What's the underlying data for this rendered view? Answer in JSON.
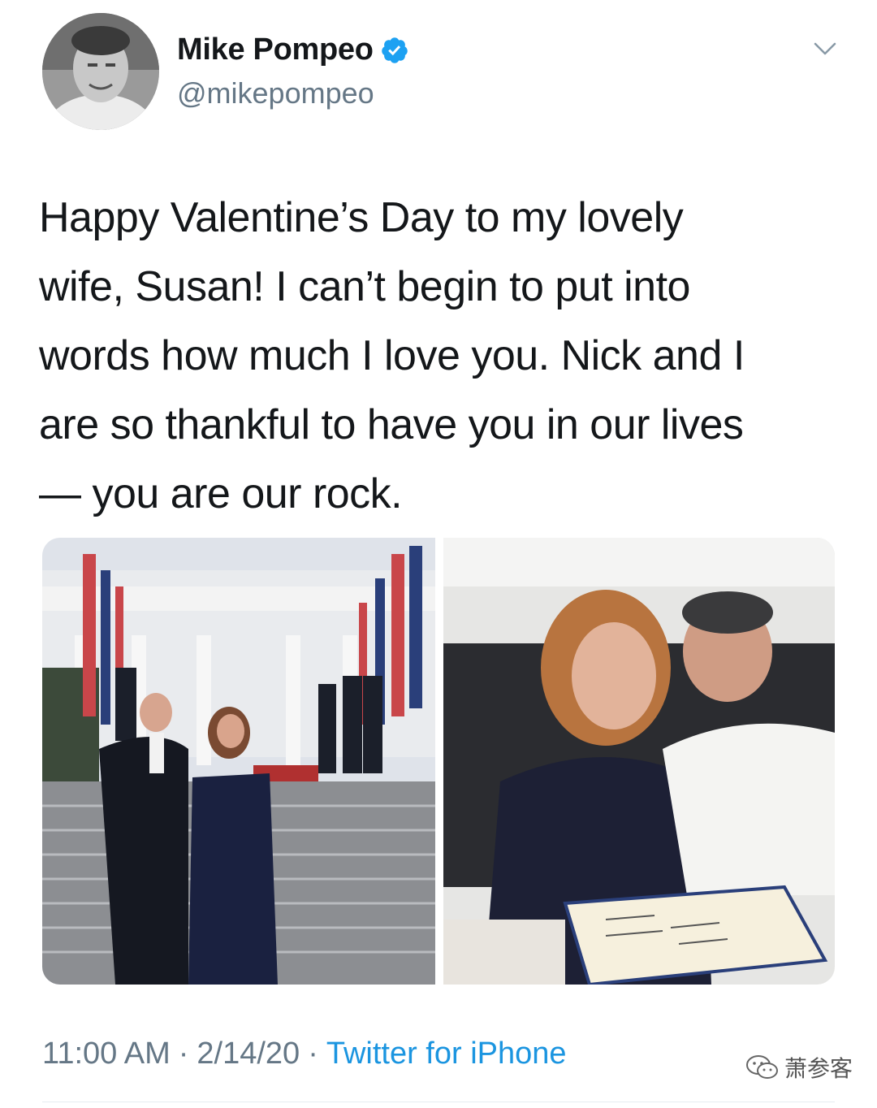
{
  "author": {
    "name": "Mike Pompeo",
    "handle": "@mikepompeo",
    "verified": true,
    "avatar_icon": "profile-photo"
  },
  "menu_icon": "chevron-down-icon",
  "tweet": {
    "text": "Happy Valentine’s Day to my lovely\nwife, Susan! I can’t begin to put into\nwords how much I love you. Nick and I\nare so thankful to have you in our lives\n— you are our rock."
  },
  "media": [
    {
      "name": "photo-couple-white-house-steps"
    },
    {
      "name": "photo-couple-restaurant-table"
    }
  ],
  "meta": {
    "time": "11:00 AM",
    "separator": "·",
    "date": "2/14/20",
    "source": "Twitter for iPhone"
  },
  "watermark": {
    "text": "萧参客",
    "icon": "wechat-icon"
  },
  "colors": {
    "text": "#14171a",
    "secondary": "#657786",
    "link": "#1b95e0",
    "verified": "#1da1f2"
  }
}
